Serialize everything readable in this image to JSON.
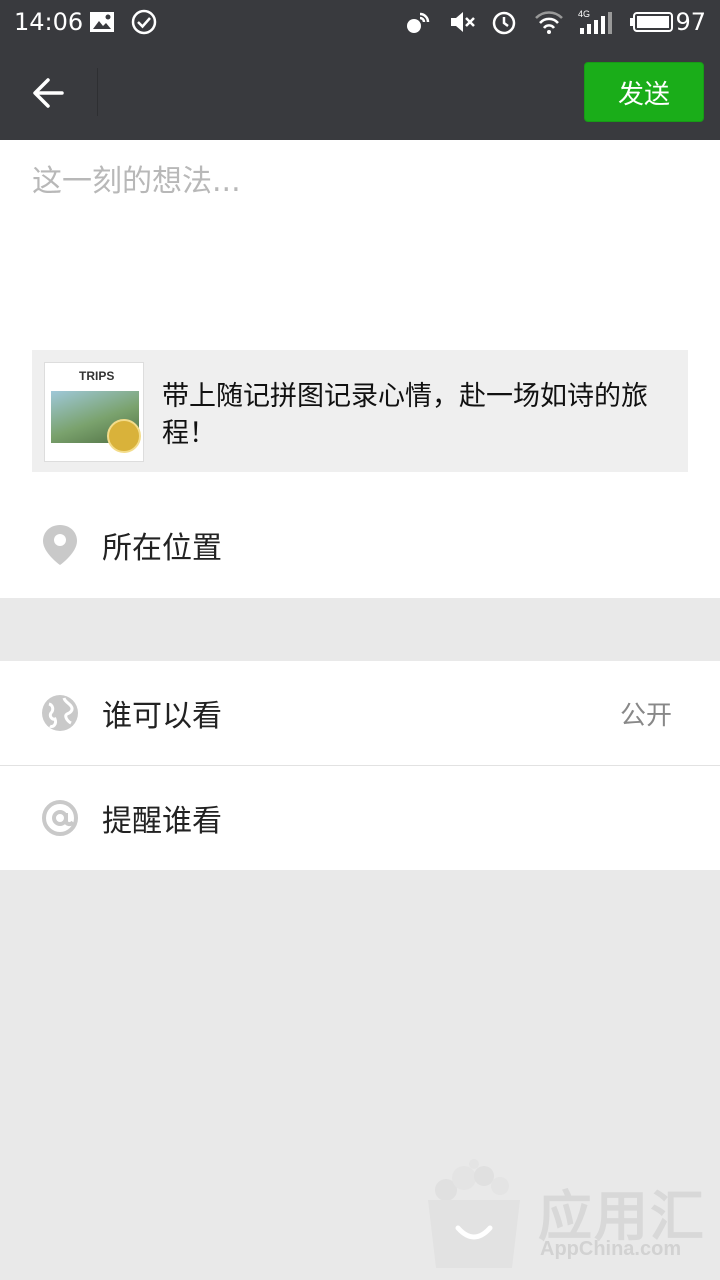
{
  "status_bar": {
    "time": "14:06",
    "battery": "97",
    "icons": [
      "image-notification-icon",
      "check-circle-icon",
      "nfc-icon",
      "mute-icon",
      "alarm-icon",
      "wifi-icon",
      "signal-4g-icon",
      "battery-icon"
    ]
  },
  "header": {
    "back_icon": "arrow-left-icon",
    "send_label": "发送",
    "accent_color": "#1aad19"
  },
  "compose": {
    "placeholder": "这一刻的想法...",
    "value": ""
  },
  "share_card": {
    "thumb_title": "TRIPS",
    "text": "带上随记拼图记录心情，赴一场如诗的旅程！"
  },
  "location": {
    "icon": "location-pin-icon",
    "label": "所在位置"
  },
  "visibility": {
    "icon": "globe-icon",
    "label": "谁可以看",
    "value": "公开"
  },
  "mention": {
    "icon": "at-icon",
    "label": "提醒谁看"
  },
  "watermark": {
    "cn": "应用汇",
    "en": "AppChina.com"
  }
}
